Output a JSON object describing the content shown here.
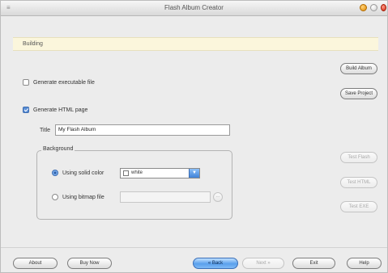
{
  "window": {
    "title": "Flash Album Creator"
  },
  "status": {
    "text": "Building"
  },
  "options": {
    "generate_executable_label": "Generate executable file",
    "generate_executable_checked": false,
    "generate_html_label": "Generate HTML page",
    "generate_html_checked": true
  },
  "title_field": {
    "label": "Title",
    "value": "My Flash Album"
  },
  "background": {
    "legend": "Background",
    "solid_color_label": "Using solid color",
    "solid_color_selected": true,
    "color_value": "white",
    "bitmap_label": "Using bitmap file",
    "bitmap_value": "",
    "browse_label": "..."
  },
  "side_buttons": {
    "build_album": "Build Album",
    "save_project": "Save Project",
    "test_flash": "Test Flash",
    "test_html": "Test HTML",
    "test_exe": "Test EXE"
  },
  "footer": {
    "about": "About",
    "buy_now": "Buy Now",
    "back": "« Back",
    "next": "Next »",
    "exit": "Exit",
    "help": "Help"
  },
  "colors": {
    "accent": "#5aa0ec",
    "status_bg": "#fbf6dc",
    "window_bg": "#ececec"
  }
}
